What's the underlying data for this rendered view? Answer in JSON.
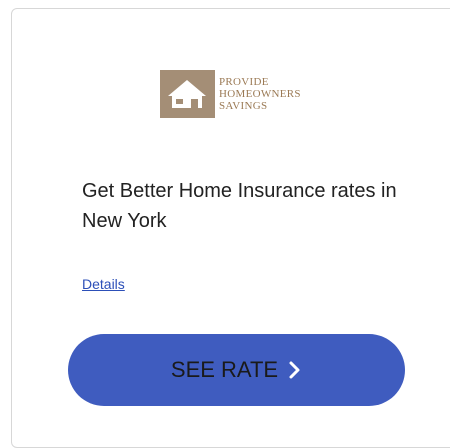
{
  "logo": {
    "lines": [
      "Provide",
      "Homeowners",
      "Savings"
    ],
    "icon": "house-icon",
    "colors": {
      "mark_bg": "#a48e76",
      "text": "#9b7a55"
    }
  },
  "headline": "Get Better Home Insurance rates in New York",
  "details_link": "Details",
  "cta": {
    "label": "SEE RATE",
    "icon": "chevron-right-icon",
    "bg": "#3f5cbf"
  }
}
